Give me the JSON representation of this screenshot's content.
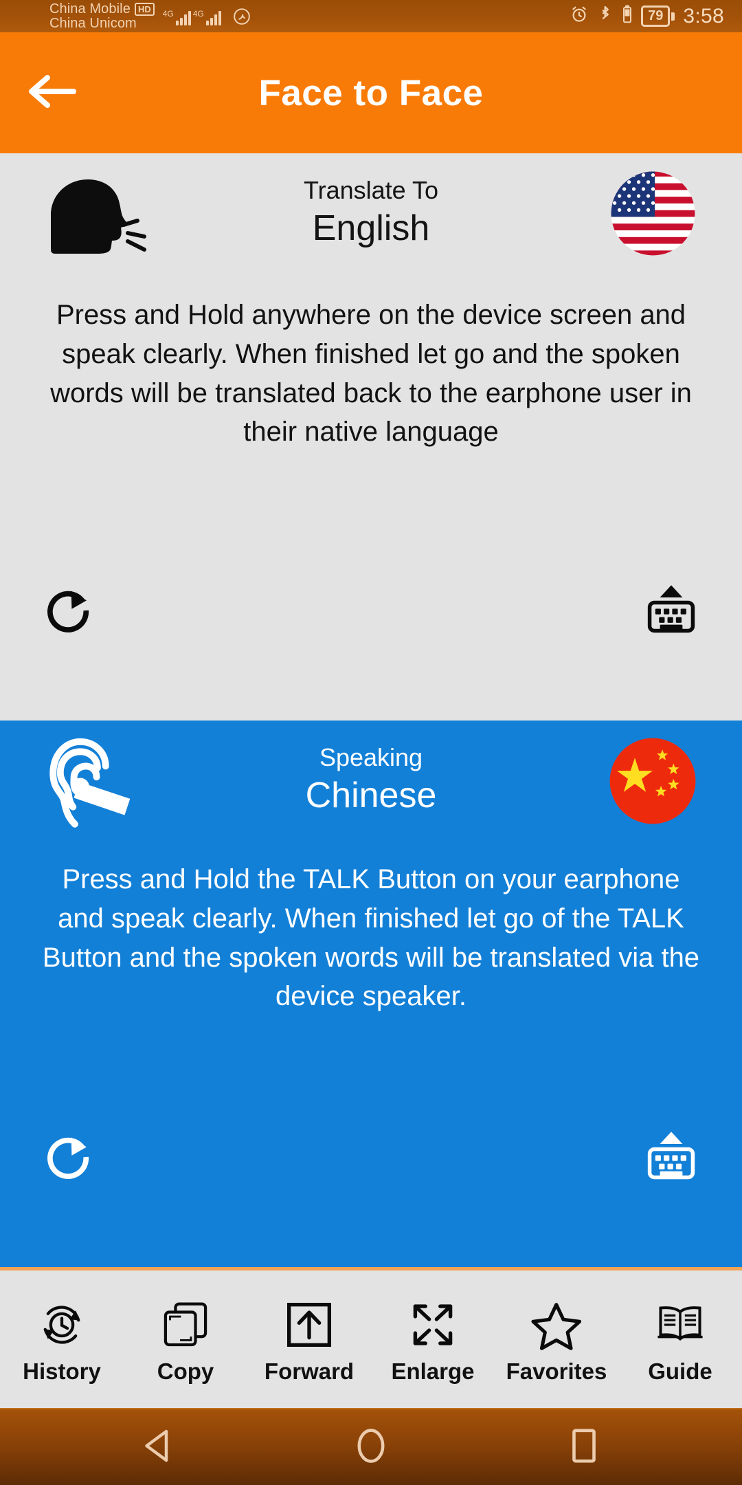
{
  "status_bar": {
    "carrier_primary": "China Mobile",
    "carrier_primary_badge": "HD",
    "carrier_secondary": "China Unicom",
    "network_1": "4G",
    "network_2": "4G",
    "music_icon": "music-note-icon",
    "alarm_icon": "alarm-clock-icon",
    "bluetooth_icon": "bluetooth-icon",
    "vibrate_icon": "battery-small-icon",
    "battery_percent": "79",
    "time": "3:58"
  },
  "app_bar": {
    "back_icon": "back-arrow-icon",
    "title": "Face to Face"
  },
  "panels": [
    {
      "id": "translate-to-panel",
      "icon_name": "speaking-head-icon",
      "label": "Translate To",
      "language": "English",
      "flag_name": "usa-flag-icon",
      "instructions": "Press and Hold anywhere on the device screen and speak clearly. When finished let go and the spoken words will be translated back to the earphone user in their native language",
      "refresh_icon": "refresh-icon",
      "keyboard_icon": "show-keyboard-icon",
      "background_color": "#e3e3e3",
      "text_color": "#121212"
    },
    {
      "id": "speaking-panel",
      "icon_name": "ear-earphone-icon",
      "label": "Speaking",
      "language": "Chinese",
      "flag_name": "china-flag-icon",
      "instructions": "Press and Hold the TALK Button on your earphone and speak clearly. When finished let go of the TALK Button and the spoken words will be translated via the device speaker.",
      "refresh_icon": "refresh-icon",
      "keyboard_icon": "show-keyboard-icon",
      "background_color": "#1380d8",
      "text_color": "#ffffff"
    }
  ],
  "toolbar": {
    "items": [
      {
        "label": "History",
        "icon": "history-clock-icon"
      },
      {
        "label": "Copy",
        "icon": "copy-icon"
      },
      {
        "label": "Forward",
        "icon": "forward-up-arrow-icon"
      },
      {
        "label": "Enlarge",
        "icon": "enlarge-fullscreen-icon"
      },
      {
        "label": "Favorites",
        "icon": "star-icon"
      },
      {
        "label": "Guide",
        "icon": "open-book-icon"
      }
    ]
  },
  "nav_bar": {
    "back_icon": "nav-back-triangle-icon",
    "home_icon": "nav-home-circle-icon",
    "recents_icon": "nav-recents-square-icon"
  },
  "colors": {
    "status_bar": "#a4520a",
    "app_bar": "#f97b07",
    "panel_top": "#e3e3e3",
    "panel_bottom": "#1380d8",
    "divider": "#f2a356"
  }
}
